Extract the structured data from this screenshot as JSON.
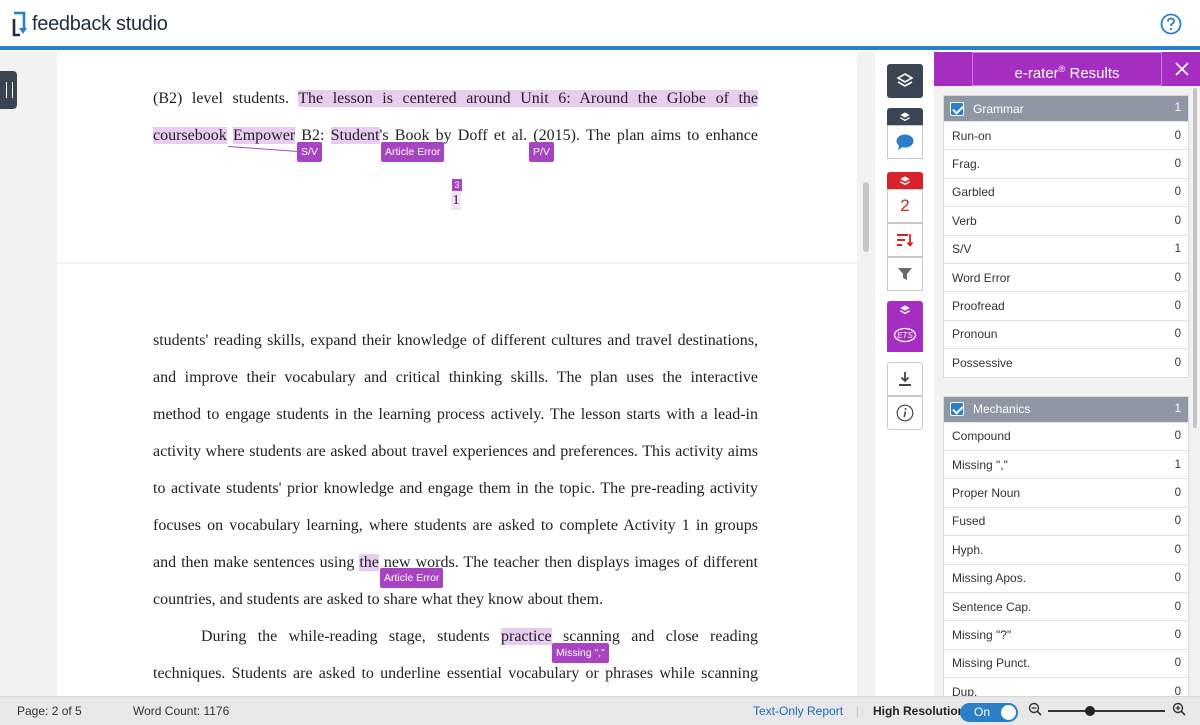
{
  "app": {
    "logo_text": "feedback studio",
    "help_icon": "question-circle-icon"
  },
  "document": {
    "page1_lines": [
      [
        {
          "t": "(B2) level students. ",
          "hl": false
        },
        {
          "t": "The lesson is centered around Unit 6: Around the Globe of the",
          "hl": true
        }
      ],
      [
        {
          "t": "coursebook",
          "hl": true
        },
        {
          "t": " ",
          "hl": false
        },
        {
          "t": "Empower",
          "hl": true
        },
        {
          "t": " B2: ",
          "hl": false
        },
        {
          "t": "Student",
          "hl": true
        },
        {
          "t": "'s Book by Doff et al.",
          "hl": false
        },
        {
          "t": " (2015). The plan aims to enhance",
          "hl": false
        }
      ]
    ],
    "page1_marks": [
      {
        "label": "S/V"
      },
      {
        "label": "Article Error"
      },
      {
        "label": "P/V"
      }
    ],
    "footnote_number": "3",
    "page_number": "1",
    "page2_lines": [
      [
        {
          "t": "students' reading skills, expand their knowledge of different cultures and travel destinations,",
          "hl": false
        }
      ],
      [
        {
          "t": "and improve their vocabulary and critical thinking skills. The plan uses the interactive",
          "hl": false
        }
      ],
      [
        {
          "t": "method to engage students in the learning process actively. The lesson starts with a lead-in",
          "hl": false
        }
      ],
      [
        {
          "t": "activity where students are asked about travel experiences and preferences. This activity aims",
          "hl": false
        }
      ],
      [
        {
          "t": "to activate students' prior knowledge and engage them in the topic. The pre-reading activity",
          "hl": false
        }
      ],
      [
        {
          "t": "focuses on vocabulary learning, where students are asked to complete Activity 1 in groups",
          "hl": false
        }
      ],
      [
        {
          "t": "and then make sentences using ",
          "hl": false
        },
        {
          "t": "the",
          "hl": true
        },
        {
          "t": " new words. The teacher then displays images of different",
          "hl": false
        }
      ],
      [
        {
          "t": "countries, and students are asked to share what they know about them.",
          "hl": false
        }
      ],
      [
        {
          "t": "During the while-reading stage, students ",
          "hl": false
        },
        {
          "t": "practice",
          "hl": true
        },
        {
          "t": " scanning and close reading",
          "hl": false
        }
      ],
      [
        {
          "t": "techniques. Students are asked to underline essential vocabulary or phrases while scanning",
          "hl": false
        }
      ]
    ],
    "page2_marks": [
      {
        "label": "Article Error"
      },
      {
        "label": "Missing \",\""
      }
    ]
  },
  "tools": {
    "icons": [
      "layers-icon",
      "layers-icon",
      "comment-icon",
      "layers-icon",
      "sort-icon",
      "filter-icon",
      "layers-icon",
      "ets-icon",
      "download-icon",
      "info-icon"
    ],
    "similarity_count": "2",
    "ets_label": "ETS"
  },
  "panel": {
    "title": "e-rater",
    "title_mark": "®",
    "title_suffix": " Results",
    "groups": [
      {
        "name": "Grammar",
        "count": "1",
        "items": [
          {
            "label": "Run-on",
            "count": "0"
          },
          {
            "label": "Frag.",
            "count": "0"
          },
          {
            "label": "Garbled",
            "count": "0"
          },
          {
            "label": "Verb",
            "count": "0"
          },
          {
            "label": "S/V",
            "count": "1"
          },
          {
            "label": "Word Error",
            "count": "0"
          },
          {
            "label": "Proofread",
            "count": "0"
          },
          {
            "label": "Pronoun",
            "count": "0"
          },
          {
            "label": "Possessive",
            "count": "0"
          }
        ]
      },
      {
        "name": "Mechanics",
        "count": "1",
        "items": [
          {
            "label": "Compound",
            "count": "0"
          },
          {
            "label": "Missing \",\"",
            "count": "1"
          },
          {
            "label": "Proper Noun",
            "count": "0"
          },
          {
            "label": "Fused",
            "count": "0"
          },
          {
            "label": "Hyph.",
            "count": "0"
          },
          {
            "label": "Missing Apos.",
            "count": "0"
          },
          {
            "label": "Sentence Cap.",
            "count": "0"
          },
          {
            "label": "Missing \"?\"",
            "count": "0"
          },
          {
            "label": "Missing Punct.",
            "count": "0"
          },
          {
            "label": "Dup.",
            "count": "0"
          }
        ]
      }
    ]
  },
  "status": {
    "page": "Page: 2 of 5",
    "word_count": "Word Count: 1176",
    "text_only_report": "Text-Only Report",
    "high_resolution": "High Resolution",
    "toggle_state": "On",
    "zoom_level": 0.36
  },
  "colors": {
    "accent": "#a52ec0",
    "highlight": "#e9cdf0",
    "tag": "#a843c2",
    "brand_blue": "#2a7fc9",
    "similarity_red": "#d8232a"
  }
}
